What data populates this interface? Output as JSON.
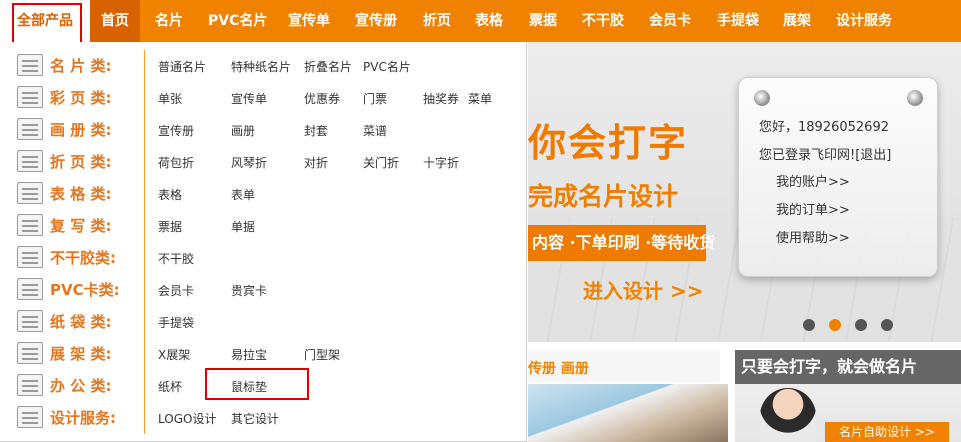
{
  "nav": {
    "all_products": "全部产品",
    "items": [
      "首页",
      "名片",
      "PVC名片",
      "宣传单",
      "宣传册",
      "折页",
      "表格",
      "票据",
      "不干胶",
      "会员卡",
      "手提袋",
      "展架",
      "设计服务"
    ]
  },
  "categories": [
    {
      "label": "名 片 类:",
      "icon": "business-card-icon",
      "subs": [
        "普通名片",
        "特种纸名片",
        "折叠名片",
        "PVC名片"
      ]
    },
    {
      "label": "彩 页 类:",
      "icon": "color-page-icon",
      "subs": [
        "单张",
        "宣传单",
        "优惠券",
        "门票",
        "抽奖券",
        "菜单"
      ]
    },
    {
      "label": "画 册 类:",
      "icon": "brochure-icon",
      "subs": [
        "宣传册",
        "画册",
        "封套",
        "菜谱"
      ]
    },
    {
      "label": "折 页 类:",
      "icon": "folded-page-icon",
      "subs": [
        "荷包折",
        "风琴折",
        "对折",
        "关门折",
        "十字折"
      ]
    },
    {
      "label": "表 格 类:",
      "icon": "form-icon",
      "subs": [
        "表格",
        "表单"
      ]
    },
    {
      "label": "复 写 类:",
      "icon": "carbon-copy-icon",
      "subs": [
        "票据",
        "单据"
      ]
    },
    {
      "label": "不干胶类:",
      "icon": "sticker-icon",
      "subs": [
        "不干胶"
      ]
    },
    {
      "label": "PVC卡类:",
      "icon": "vip-card-icon",
      "subs": [
        "会员卡",
        "贵宾卡"
      ]
    },
    {
      "label": "纸 袋 类:",
      "icon": "paper-bag-icon",
      "subs": [
        "手提袋"
      ]
    },
    {
      "label": "展 架 类:",
      "icon": "display-stand-icon",
      "subs": [
        "X展架",
        "易拉宝",
        "门型架"
      ]
    },
    {
      "label": "办 公 类:",
      "icon": "office-icon",
      "subs": [
        "纸杯",
        "鼠标垫"
      ]
    },
    {
      "label": "设计服务:",
      "icon": "pencil-icon",
      "subs": [
        "LOGO设计",
        "其它设计"
      ]
    }
  ],
  "banner": {
    "headline": "你会打字",
    "subline": "完成名片设计",
    "ribbon": "内容 ·下单印刷 ·等待收货",
    "enter": "进入设计 >>"
  },
  "login": {
    "greeting": "您好，18926052692",
    "status": "您已登录飞印网![退出]",
    "links": [
      "我的账户>>",
      "我的订单>>",
      "使用帮助>>"
    ]
  },
  "panel_a": {
    "title": "传册 画册"
  },
  "panel_b": {
    "title": "只要会打字，就会做名片",
    "button": "名片自助设计 >>"
  },
  "colors": {
    "accent": "#f08200",
    "highlight_outline": "#e00000"
  }
}
